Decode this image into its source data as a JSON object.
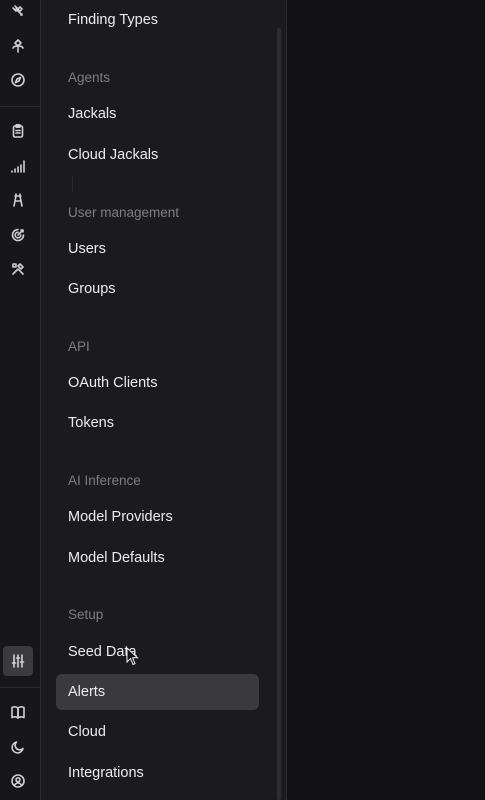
{
  "sidebar": {
    "finding_types": "Finding Types",
    "sections": {
      "agents": "Agents",
      "user_management": "User management",
      "api": "API",
      "ai_inference": "AI Inference",
      "setup": "Setup"
    },
    "items": {
      "jackals": "Jackals",
      "cloud_jackals": "Cloud Jackals",
      "users": "Users",
      "groups": "Groups",
      "oauth_clients": "OAuth Clients",
      "tokens": "Tokens",
      "model_providers": "Model Providers",
      "model_defaults": "Model Defaults",
      "seed_data": "Seed Data",
      "alerts": "Alerts",
      "cloud": "Cloud",
      "integrations": "Integrations"
    },
    "active_item": "Alerts"
  },
  "rail": {
    "icons": [
      "satellite-icon",
      "route-icon",
      "compass-icon",
      "clipboard-icon",
      "signal-icon",
      "tower-icon",
      "target-icon",
      "tools-icon",
      "settings-sliders-icon",
      "book-icon",
      "moon-icon",
      "user-circle-icon"
    ],
    "active_icon": "settings-sliders-icon"
  },
  "colors": {
    "background": "#121214",
    "panel": "#1b1b1e",
    "active": "#3a3a3e",
    "text": "#ececef",
    "muted": "#7d7d84"
  }
}
